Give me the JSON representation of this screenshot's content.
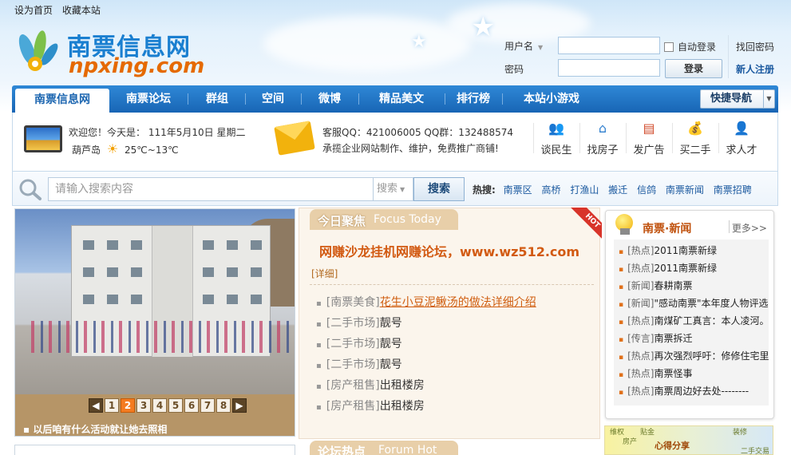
{
  "toplinks": {
    "set_home": "设为首页",
    "bookmark": "收藏本站"
  },
  "logo": {
    "cn": "南票信息网",
    "en": "npxing.com"
  },
  "login": {
    "username_label": "用户名",
    "password_label": "密码",
    "auto_login": "自动登录",
    "login_button": "登录",
    "find_password": "找回密码",
    "register": "新人注册"
  },
  "nav": {
    "items": [
      "南票信息网",
      "南票论坛",
      "群组",
      "空间",
      "微博",
      "精品美文",
      "排行榜",
      "本站小游戏"
    ],
    "quick_nav": "快捷导航"
  },
  "info": {
    "welcome": "欢迎您！今天是：",
    "date": "111年5月10日 星期二",
    "city": "葫芦岛",
    "temperature": "25℃~13℃",
    "service_qq": "客服QQ：421006005 QQ群：132488574",
    "business": "承揽企业网站制作、维护，免费推广商铺!"
  },
  "quick_buttons": [
    {
      "label": "谈民生",
      "icon": "people-icon"
    },
    {
      "label": "找房子",
      "icon": "house-icon"
    },
    {
      "label": "发广告",
      "icon": "ad-icon"
    },
    {
      "label": "买二手",
      "icon": "money-bag-icon"
    },
    {
      "label": "求人才",
      "icon": "person-icon"
    }
  ],
  "search": {
    "placeholder": "请输入搜索内容",
    "type_selected": "搜索",
    "button": "搜索",
    "hot_label": "热搜:",
    "hot_keywords": [
      "南票区",
      "高桥",
      "打渔山",
      "搬迁",
      "信鸽",
      "南票新闻",
      "南票招聘"
    ]
  },
  "slideshow": {
    "pages": [
      "1",
      "2",
      "3",
      "4",
      "5",
      "6",
      "7",
      "8"
    ],
    "current_page": "2",
    "caption": "以后咱有什么活动就让她去照相"
  },
  "focus": {
    "tab_cn": "今日聚焦",
    "tab_en": "Focus Today",
    "hot_badge": "HOT",
    "headline": "网赚沙龙挂机网赚论坛，www.wz512.com",
    "detail": "[详细]",
    "news": [
      {
        "category": "[南票美食]",
        "title": "花生小豆泥鳅汤的做法详细介绍"
      },
      {
        "category": "[二手市场]",
        "title": "靓号"
      },
      {
        "category": "[二手市场]",
        "title": "靓号"
      },
      {
        "category": "[二手市场]",
        "title": "靓号"
      },
      {
        "category": "[房产租售]",
        "title": "出租楼房"
      },
      {
        "category": "[房产租售]",
        "title": "出租楼房"
      }
    ]
  },
  "forum_hot": {
    "tab_cn": "论坛热点",
    "tab_en": "Forum Hot"
  },
  "right_news": {
    "title": "南票·新闻",
    "more": "更多>>",
    "items": [
      {
        "category": "[热点]",
        "title": "2011南票新绿"
      },
      {
        "category": "[热点]",
        "title": "2011南票新绿"
      },
      {
        "category": "[新闻]",
        "title": "春耕南票"
      },
      {
        "category": "[新闻]",
        "title": "\"感动南票\"本年度人物评选"
      },
      {
        "category": "[热点]",
        "title": "南煤矿工真言：本人凌河。"
      },
      {
        "category": "[传言]",
        "title": "南票拆迁"
      },
      {
        "category": "[热点]",
        "title": "再次强烈呼吁：修修住宅里"
      },
      {
        "category": "[热点]",
        "title": "南票怪事"
      },
      {
        "category": "[热点]",
        "title": "南票周边好去处--------"
      }
    ]
  },
  "ad_banner": {
    "share": "心得分享",
    "tags": [
      "维权",
      "贴金",
      "装修",
      "房产",
      "二手交易"
    ]
  },
  "colors": {
    "nav_blue": "#1f72c4",
    "logo_blue": "#1a7fd0",
    "logo_orange": "#e56a00",
    "focus_orange": "#d25a12",
    "page_active": "#f47b20"
  }
}
